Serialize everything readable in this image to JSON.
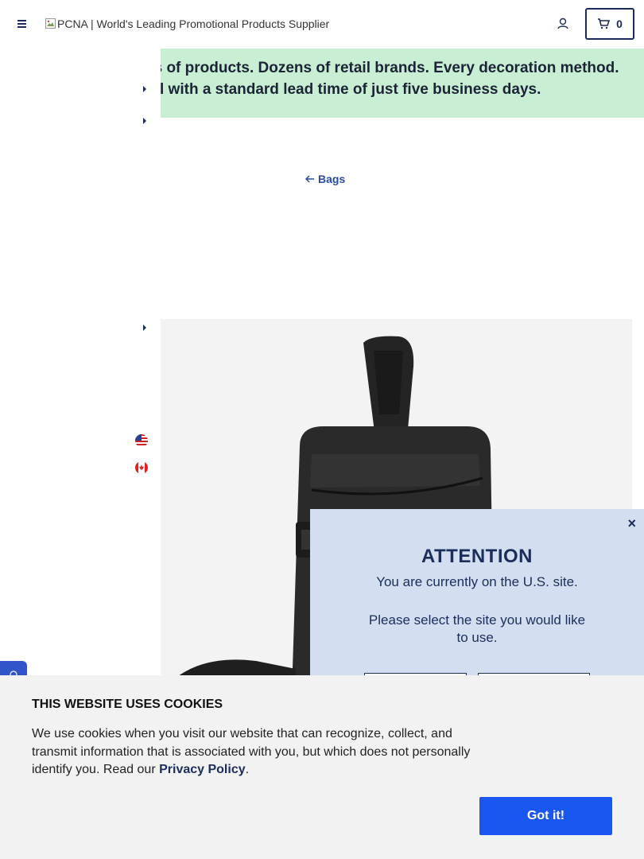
{
  "header": {
    "logo_alt": "PCNA | World's Leading Promotional Products Supplier",
    "cart_count": "0"
  },
  "banner": {
    "text": "ds of products. Dozens of retail brands. Every decoration method. All with a standard lead time of just five business days."
  },
  "nav": {
    "back_label": "Bags"
  },
  "attention": {
    "title": "ATTENTION",
    "current_site": "You are currently on the U.S. site.",
    "prompt": "Please select the site you would like to use.",
    "close_label": "×"
  },
  "cookie": {
    "title": "THIS WEBSITE USES COOKIES",
    "body": "We use cookies when you visit our website that can recognize, collect, and transmit information that is associated with you, but which does not personally identify you. Read our ",
    "link_label": "Privacy Policy",
    "suffix": ".",
    "button_label": "Got it!"
  },
  "colors": {
    "brand_navy": "#1b2d5b",
    "banner_green": "#c8efd3",
    "modal_blue": "#d3dff0",
    "button_blue": "#1a56f0"
  }
}
